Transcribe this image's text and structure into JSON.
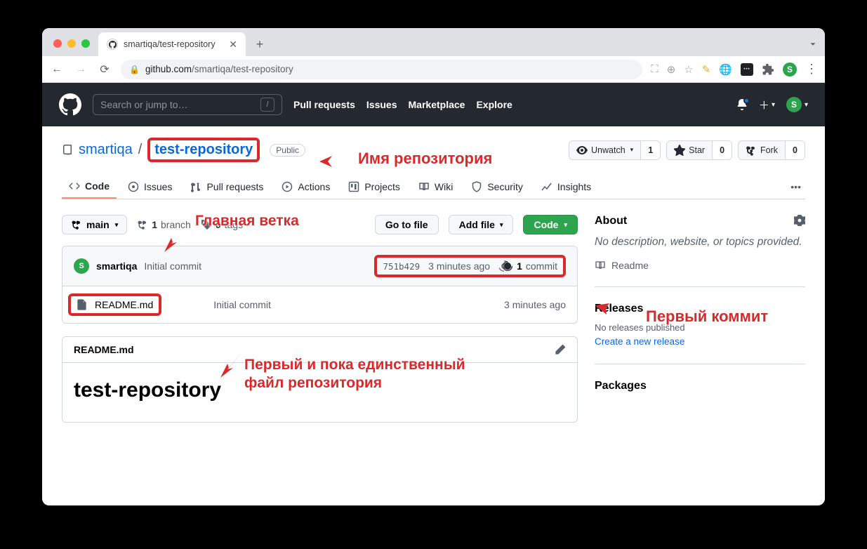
{
  "browser": {
    "tab_title": "smartiqa/test-repository",
    "url_host": "github.com",
    "url_path": "/smartiqa/test-repository"
  },
  "gh": {
    "search_placeholder": "Search or jump to…",
    "slash": "/",
    "nav": {
      "pulls": "Pull requests",
      "issues": "Issues",
      "market": "Marketplace",
      "explore": "Explore"
    },
    "avatar_initial": "S"
  },
  "repo": {
    "owner": "smartiqa",
    "name": "test-repository",
    "visibility": "Public",
    "actions": {
      "unwatch": "Unwatch",
      "unwatch_count": "1",
      "star": "Star",
      "star_count": "0",
      "fork": "Fork",
      "fork_count": "0"
    }
  },
  "tabs": {
    "code": "Code",
    "issues": "Issues",
    "pulls": "Pull requests",
    "actions": "Actions",
    "projects": "Projects",
    "wiki": "Wiki",
    "security": "Security",
    "insights": "Insights"
  },
  "branch": {
    "current": "main",
    "branch_count": "1",
    "branch_word": "branch",
    "tag_count": "0",
    "tag_word": "tags"
  },
  "buttons": {
    "go_to_file": "Go to file",
    "add_file": "Add file",
    "code": "Code"
  },
  "commit": {
    "user": "smartiqa",
    "msg": "Initial commit",
    "sha": "751b429",
    "ago": "3 minutes ago",
    "count": "1",
    "count_word": "commit"
  },
  "file": {
    "name": "README.md",
    "msg": "Initial commit",
    "ago": "3 minutes ago"
  },
  "readme": {
    "head": "README.md",
    "h1": "test-repository"
  },
  "sidebar": {
    "about": "About",
    "desc": "No description, website, or topics provided.",
    "readme_link": "Readme",
    "releases": "Releases",
    "no_releases": "No releases published",
    "create_release": "Create a new release",
    "packages": "Packages"
  },
  "annotations": {
    "repo_name": "Имя репозитория",
    "main_branch": "Главная ветка",
    "first_commit": "Первый коммит",
    "only_file_l1": "Первый и пока единственный",
    "only_file_l2": "файл репозитория"
  }
}
